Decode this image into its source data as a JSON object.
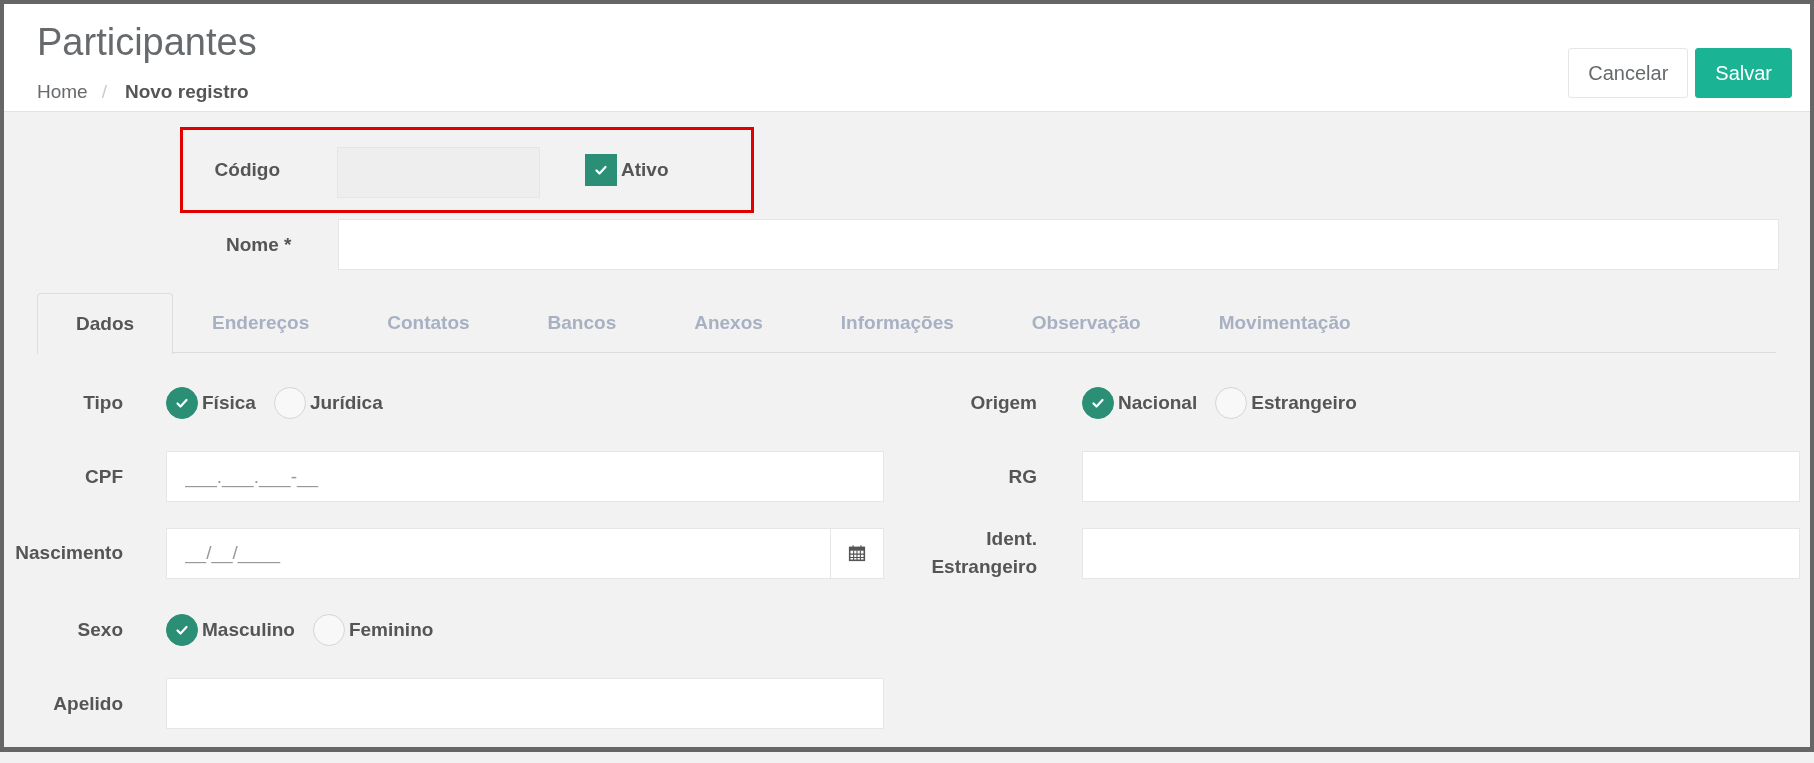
{
  "header": {
    "title": "Participantes",
    "breadcrumb_separator": "/",
    "breadcrumb": [
      {
        "label": "Home",
        "current": false
      },
      {
        "label": "Novo registro",
        "current": true
      }
    ],
    "buttons": [
      {
        "label": "Cancelar",
        "kind": "secondary"
      },
      {
        "label": "Salvar",
        "kind": "primary"
      }
    ]
  },
  "code_row": {
    "label": "Código",
    "value_disabled": true,
    "active": {
      "label": "Ativo",
      "checked": true
    }
  },
  "name_row": {
    "label": "Nome *"
  },
  "tabs": [
    {
      "label": "Dados",
      "selected": true
    },
    {
      "label": "Endereços",
      "selected": false
    },
    {
      "label": "Contatos",
      "selected": false
    },
    {
      "label": "Bancos",
      "selected": false
    },
    {
      "label": "Anexos",
      "selected": false
    },
    {
      "label": "Informações",
      "selected": false
    },
    {
      "label": "Observação",
      "selected": false
    },
    {
      "label": "Movimentação",
      "selected": false
    }
  ],
  "form_rows": [
    {
      "left": {
        "kind": "radio",
        "label": "Tipo",
        "options": [
          {
            "label": "Física",
            "selected": true
          },
          {
            "label": "Jurídica",
            "selected": false
          }
        ]
      },
      "right": {
        "kind": "radio",
        "label": "Origem",
        "options": [
          {
            "label": "Nacional",
            "selected": true
          },
          {
            "label": "Estrangeiro",
            "selected": false
          }
        ]
      }
    },
    {
      "left": {
        "kind": "text",
        "label": "CPF",
        "placeholder": "___.___.___-__"
      },
      "right": {
        "kind": "text",
        "label": "RG"
      }
    },
    {
      "left": {
        "kind": "date",
        "label": "Nascimento",
        "placeholder": "__/__/____"
      },
      "right": {
        "kind": "text",
        "label": "Ident. Estrangeiro"
      }
    },
    {
      "left": {
        "kind": "radio",
        "label": "Sexo",
        "options": [
          {
            "label": "Masculino",
            "selected": true
          },
          {
            "label": "Feminino",
            "selected": false
          }
        ]
      }
    },
    {
      "left": {
        "kind": "text",
        "label": "Apelido"
      }
    }
  ]
}
